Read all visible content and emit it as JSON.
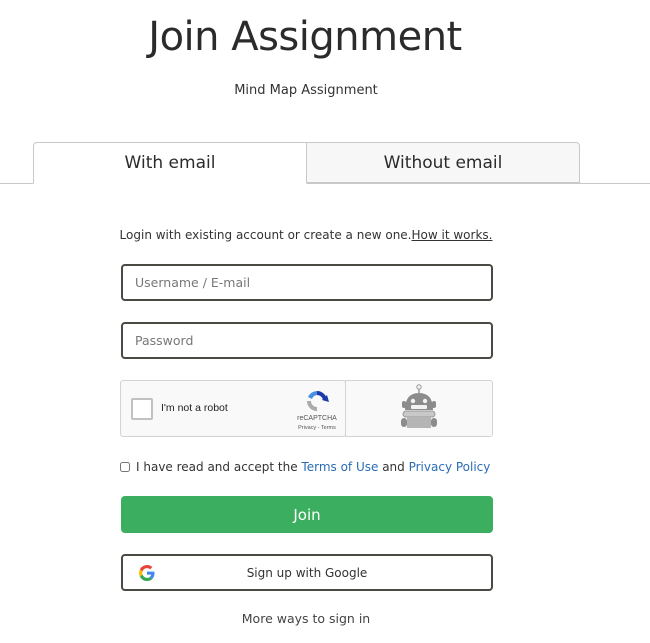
{
  "header": {
    "title": "Join Assignment",
    "subtitle": "Mind Map Assignment"
  },
  "tabs": [
    {
      "label": "With email",
      "active": true
    },
    {
      "label": "Without email",
      "active": false
    }
  ],
  "info": {
    "text": "Login with existing account or create a new one.",
    "link": "How it works."
  },
  "form": {
    "username": {
      "value": "",
      "placeholder": "Username / E-mail"
    },
    "password": {
      "value": "",
      "placeholder": "Password"
    }
  },
  "captcha": {
    "label": "I'm not a robot",
    "brand": "reCAPTCHA",
    "terms": "Privacy - Terms",
    "checked": false
  },
  "terms": {
    "prefix": "I have read and accept the ",
    "terms_link": "Terms of Use",
    "middle": " and ",
    "privacy_link": "Privacy Policy",
    "checked": false
  },
  "buttons": {
    "join": "Join",
    "google": "Sign up with Google",
    "more_ways": "More ways to sign in"
  },
  "colors": {
    "primary_green": "#3cae5f",
    "link_blue": "#2a6db5"
  }
}
